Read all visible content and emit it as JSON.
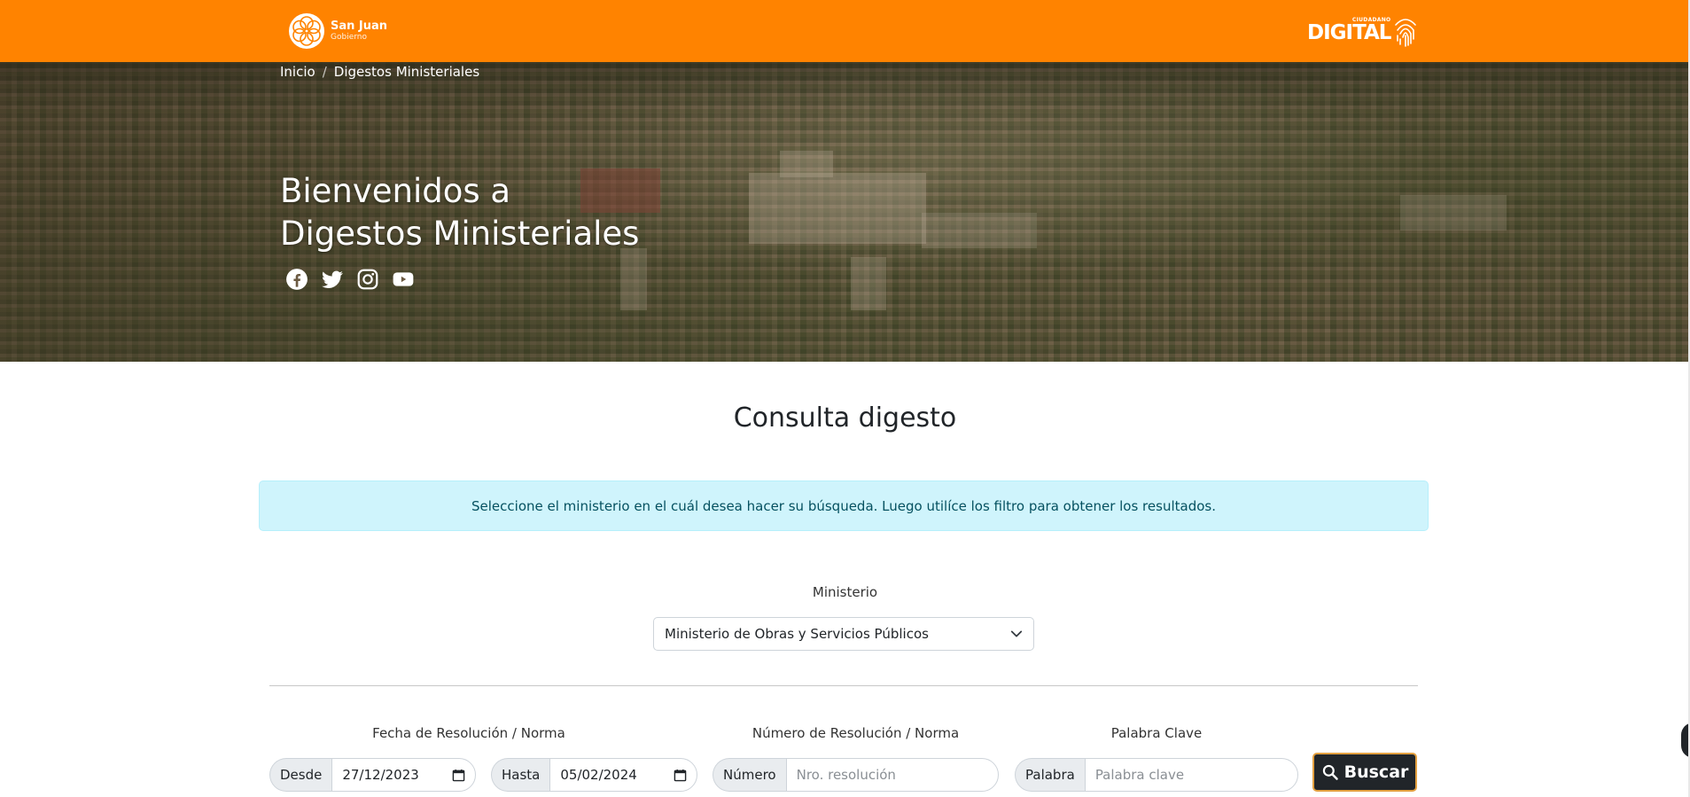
{
  "header": {
    "logo_left_name": "San Juan",
    "logo_left_sub": "Gobierno",
    "logo_right_small": "CIUDADANO",
    "logo_right_big": "DIGITAL"
  },
  "breadcrumb": {
    "home": "Inicio",
    "separator": "/",
    "current": "Digestos Ministeriales"
  },
  "hero": {
    "title_line1": "Bienvenidos a",
    "title_line2": "Digestos Ministeriales",
    "socials": [
      "facebook-icon",
      "twitter-icon",
      "instagram-icon",
      "youtube-icon"
    ]
  },
  "main": {
    "title": "Consulta digesto",
    "alert": "Seleccione el ministerio en el cuál desea hacer su búsqueda. Luego utilíce los filtro para obtener los resultados.",
    "ministerio_label": "Ministerio",
    "ministerio_selected": "Ministerio de Obras y Servicios Públicos"
  },
  "filters": {
    "fecha_label": "Fecha de Resolución / Norma",
    "desde_addon": "Desde",
    "desde_value": "27/12/2023",
    "hasta_addon": "Hasta",
    "hasta_value": "05/02/2024",
    "numero_label": "Número de Resolución / Norma",
    "numero_addon": "Número",
    "numero_placeholder": "Nro. resolución",
    "palabra_label": "Palabra Clave",
    "palabra_addon": "Palabra",
    "palabra_placeholder": "Palabra clave",
    "buscar_label": "Buscar"
  },
  "colors": {
    "brand_orange": "#ff8300",
    "alert_bg": "#cff4fc",
    "alert_text": "#055160",
    "button_dark": "#212529"
  }
}
